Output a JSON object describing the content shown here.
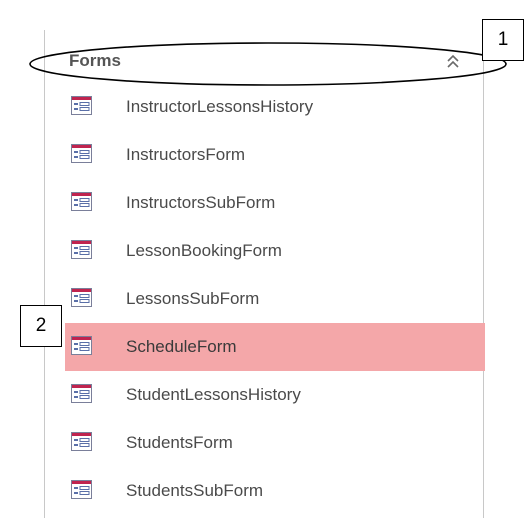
{
  "nav_pane": {
    "group_title": "Forms",
    "collapse_icon": "double-chevron-up-icon",
    "item_icon": "form-icon",
    "items": [
      {
        "label": "InstructorLessonsHistory",
        "selected": false
      },
      {
        "label": "InstructorsForm",
        "selected": false
      },
      {
        "label": "InstructorsSubForm",
        "selected": false
      },
      {
        "label": "LessonBookingForm",
        "selected": false
      },
      {
        "label": "LessonsSubForm",
        "selected": false
      },
      {
        "label": "ScheduleForm",
        "selected": true
      },
      {
        "label": "StudentLessonsHistory",
        "selected": false
      },
      {
        "label": "StudentsForm",
        "selected": false
      },
      {
        "label": "StudentsSubForm",
        "selected": false
      }
    ],
    "selected_color": "#f4a7a9"
  },
  "callouts": {
    "one": "1",
    "two": "2"
  }
}
